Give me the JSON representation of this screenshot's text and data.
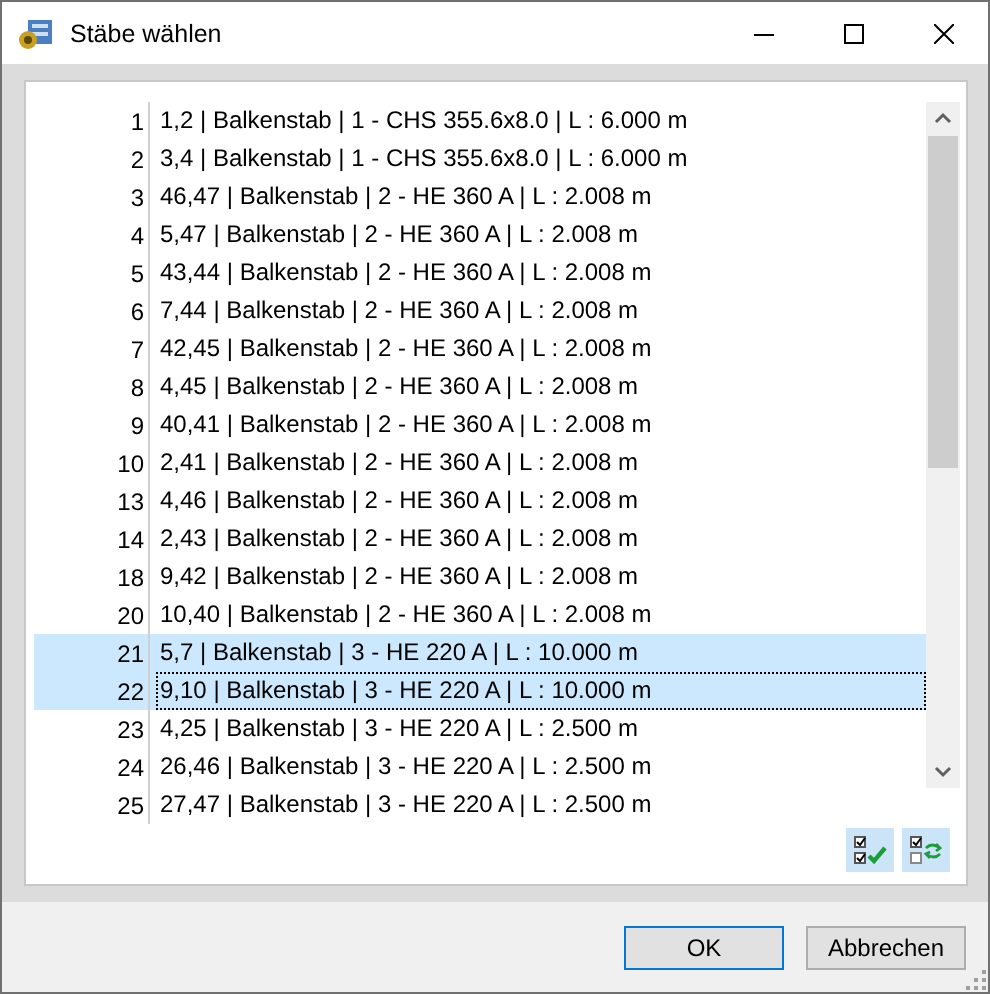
{
  "window": {
    "title": "Stäbe wählen"
  },
  "rows": [
    {
      "number": "1",
      "text": "1,2 | Balkenstab | 1 - CHS 355.6x8.0 | L : 6.000 m",
      "selected": false,
      "focused": false
    },
    {
      "number": "2",
      "text": "3,4 | Balkenstab | 1 - CHS 355.6x8.0 | L : 6.000 m",
      "selected": false,
      "focused": false
    },
    {
      "number": "3",
      "text": "46,47 | Balkenstab | 2 - HE 360 A | L : 2.008 m",
      "selected": false,
      "focused": false
    },
    {
      "number": "4",
      "text": "5,47 | Balkenstab | 2 - HE 360 A | L : 2.008 m",
      "selected": false,
      "focused": false
    },
    {
      "number": "5",
      "text": "43,44 | Balkenstab | 2 - HE 360 A | L : 2.008 m",
      "selected": false,
      "focused": false
    },
    {
      "number": "6",
      "text": "7,44 | Balkenstab | 2 - HE 360 A | L : 2.008 m",
      "selected": false,
      "focused": false
    },
    {
      "number": "7",
      "text": "42,45 | Balkenstab | 2 - HE 360 A | L : 2.008 m",
      "selected": false,
      "focused": false
    },
    {
      "number": "8",
      "text": "4,45 | Balkenstab | 2 - HE 360 A | L : 2.008 m",
      "selected": false,
      "focused": false
    },
    {
      "number": "9",
      "text": "40,41 | Balkenstab | 2 - HE 360 A | L : 2.008 m",
      "selected": false,
      "focused": false
    },
    {
      "number": "10",
      "text": "2,41 | Balkenstab | 2 - HE 360 A | L : 2.008 m",
      "selected": false,
      "focused": false
    },
    {
      "number": "13",
      "text": "4,46 | Balkenstab | 2 - HE 360 A | L : 2.008 m",
      "selected": false,
      "focused": false
    },
    {
      "number": "14",
      "text": "2,43 | Balkenstab | 2 - HE 360 A | L : 2.008 m",
      "selected": false,
      "focused": false
    },
    {
      "number": "18",
      "text": "9,42 | Balkenstab | 2 - HE 360 A | L : 2.008 m",
      "selected": false,
      "focused": false
    },
    {
      "number": "20",
      "text": "10,40 | Balkenstab | 2 - HE 360 A | L : 2.008 m",
      "selected": false,
      "focused": false
    },
    {
      "number": "21",
      "text": "5,7 | Balkenstab | 3 - HE 220 A | L : 10.000 m",
      "selected": true,
      "focused": false
    },
    {
      "number": "22",
      "text": "9,10 | Balkenstab | 3 - HE 220 A | L : 10.000 m",
      "selected": true,
      "focused": true
    },
    {
      "number": "23",
      "text": "4,25 | Balkenstab | 3 - HE 220 A | L : 2.500 m",
      "selected": false,
      "focused": false
    },
    {
      "number": "24",
      "text": "26,46 | Balkenstab | 3 - HE 220 A | L : 2.500 m",
      "selected": false,
      "focused": false
    },
    {
      "number": "25",
      "text": "27,47 | Balkenstab | 3 - HE 220 A | L : 2.500 m",
      "selected": false,
      "focused": false
    }
  ],
  "buttons": [
    "OK",
    "Abbrechen"
  ]
}
